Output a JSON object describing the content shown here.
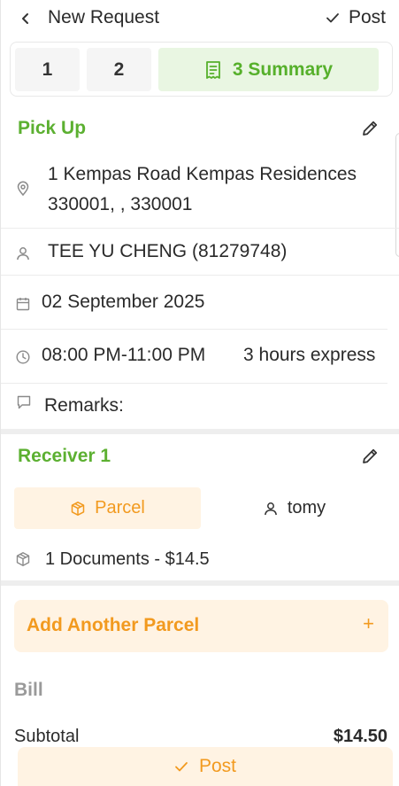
{
  "header": {
    "title": "New Request",
    "post_label": "Post"
  },
  "tabs": [
    {
      "label": "1"
    },
    {
      "label": "2"
    },
    {
      "label": "3 Summary",
      "active": true
    }
  ],
  "pickup": {
    "section_title": "Pick Up",
    "address_line1": "1 Kempas Road Kempas Residences",
    "address_line2": "330001, , 330001",
    "contact": "TEE YU CHENG (81279748)",
    "date": "02 September 2025",
    "time": "08:00 PM-11:00 PM",
    "service": "3 hours express",
    "remarks_label": "Remarks:"
  },
  "receiver": {
    "section_title": "Receiver 1",
    "parcel_tab": "Parcel",
    "recipient_tab": "tomy",
    "item": "1 Documents - $14.5"
  },
  "add_parcel": {
    "label": "Add Another Parcel",
    "plus": "+"
  },
  "bill": {
    "title": "Bill",
    "subtotal_label": "Subtotal",
    "subtotal_value": "$14.50"
  },
  "footer": {
    "post_label": "Post"
  },
  "colors": {
    "green": "#5cb031",
    "green_bg": "#e9f6e2",
    "orange": "#f29a1f",
    "orange_bg": "#fff3e3"
  }
}
